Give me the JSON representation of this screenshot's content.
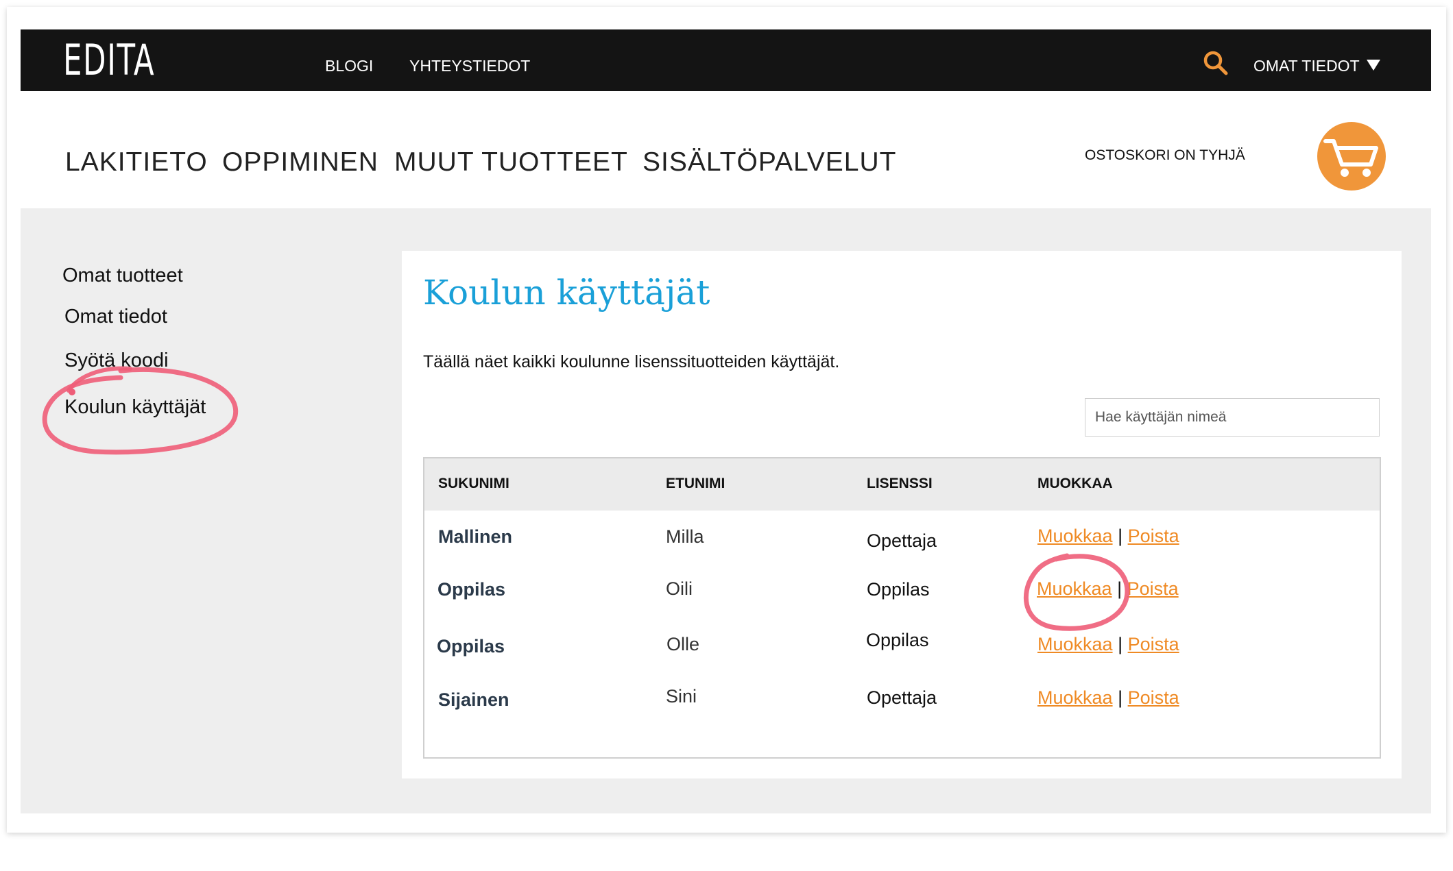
{
  "topbar": {
    "logo": "EDITA",
    "nav": [
      "BLOGI",
      "YHTEYSTIEDOT"
    ],
    "account_label": "OMAT TIEDOT",
    "icons": {
      "search": "search-icon",
      "account_menu": "chevron-down-icon"
    },
    "accent_color": "#f0963a"
  },
  "mainnav": {
    "items": [
      "LAKITIETO",
      "OPPIMINEN",
      "MUUT TUOTTEET",
      "SISÄLTÖPALVELUT"
    ],
    "cart_status": "OSTOSKORI ON TYHJÄ"
  },
  "sidebar": {
    "items": [
      "Omat tuotteet",
      "Omat tiedot",
      "Syötä koodi",
      "Koulun käyttäjät"
    ]
  },
  "main": {
    "title": "Koulun käyttäjät",
    "intro": "Täällä näet kaikki koulunne lisenssituotteiden käyttäjät.",
    "search_placeholder": "Hae käyttäjän nimeä",
    "table": {
      "headers": [
        "SUKUNIMI",
        "ETUNIMI",
        "LISENSSI",
        "MUOKKAA"
      ],
      "rows": [
        {
          "lastname": "Mallinen",
          "firstname": "Milla",
          "license": "Opettaja",
          "edit": "Muokkaa",
          "separator": "|",
          "delete": "Poista"
        },
        {
          "lastname": "Oppilas",
          "firstname": "Oili",
          "license": "Oppilas",
          "edit": "Muokkaa",
          "separator": "|",
          "delete": "Poista"
        },
        {
          "lastname": "Oppilas",
          "firstname": "Olle",
          "license": "Oppilas",
          "edit": "Muokkaa",
          "separator": "|",
          "delete": "Poista"
        },
        {
          "lastname": "Sijainen",
          "firstname": "Sini",
          "license": "Opettaja",
          "edit": "Muokkaa",
          "separator": "|",
          "delete": "Poista"
        }
      ]
    }
  },
  "colors": {
    "title_blue": "#1aa0d8",
    "link_orange": "#ef8a24",
    "annotation_red": "#ee5d78"
  }
}
